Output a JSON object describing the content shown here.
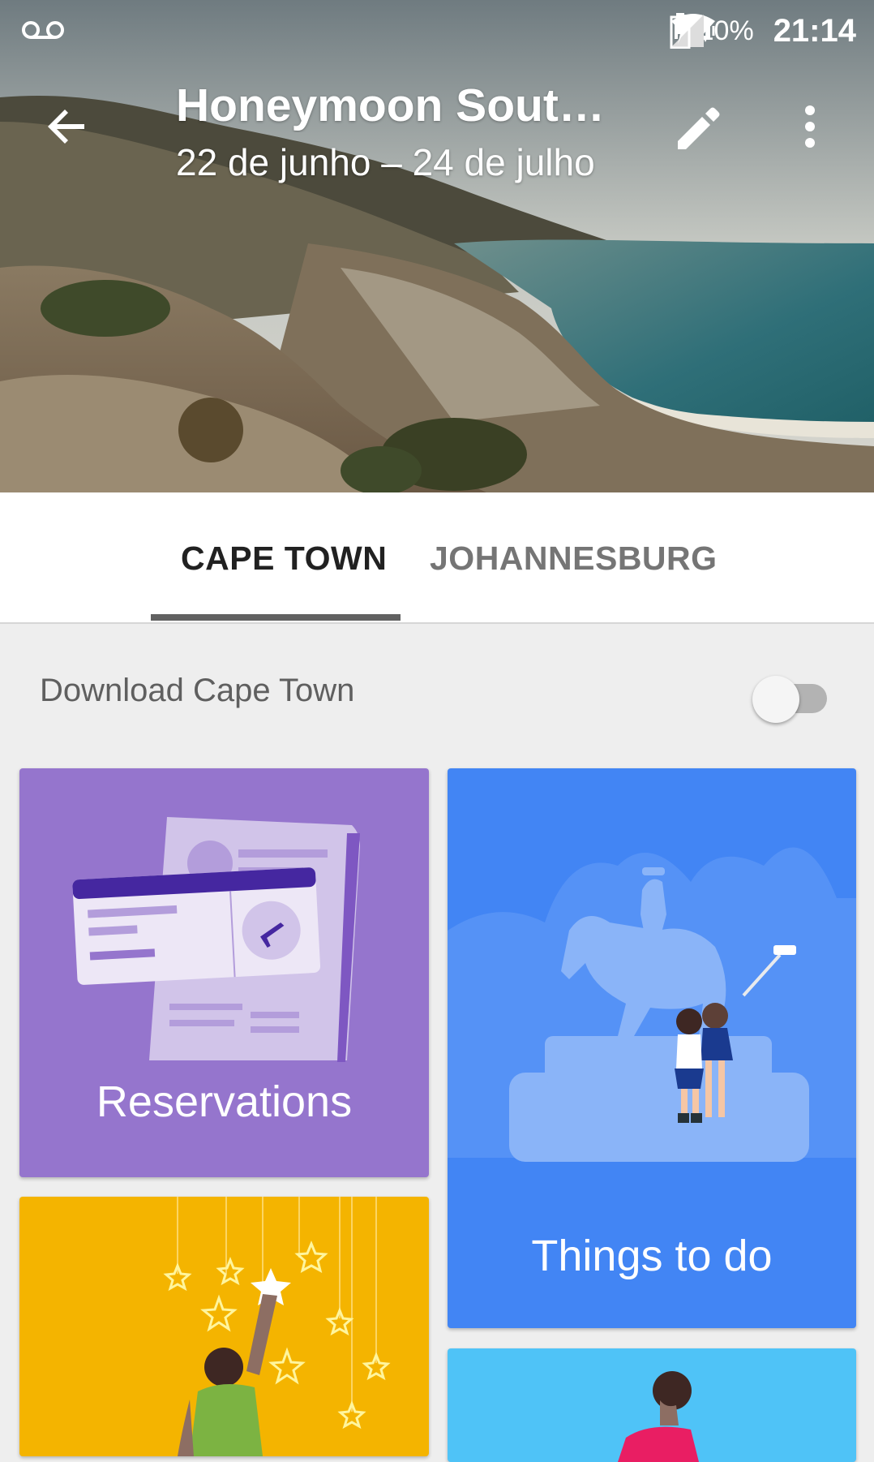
{
  "status_bar": {
    "battery_percent": "10%",
    "time": "21:14",
    "icons": [
      "voicemail-icon",
      "vibrate-icon",
      "wifi-icon",
      "signal-icon",
      "battery-charging-icon"
    ]
  },
  "header": {
    "title": "Honeymoon South…",
    "subtitle": "22 de junho – 24 de julho",
    "icons": [
      "back-arrow-icon",
      "edit-pencil-icon",
      "more-vert-icon"
    ]
  },
  "tabs": [
    {
      "label": "CAPE TOWN",
      "selected": true
    },
    {
      "label": "JOHANNESBURG",
      "selected": false
    }
  ],
  "download": {
    "label": "Download Cape Town",
    "enabled": false
  },
  "cards": [
    {
      "label": "Reservations",
      "color": "#9575cd"
    },
    {
      "label": "Things to do",
      "color": "#4285f4"
    },
    {
      "label": "",
      "color": "#f4b400"
    },
    {
      "label": "",
      "color": "#4fc3f7"
    }
  ]
}
